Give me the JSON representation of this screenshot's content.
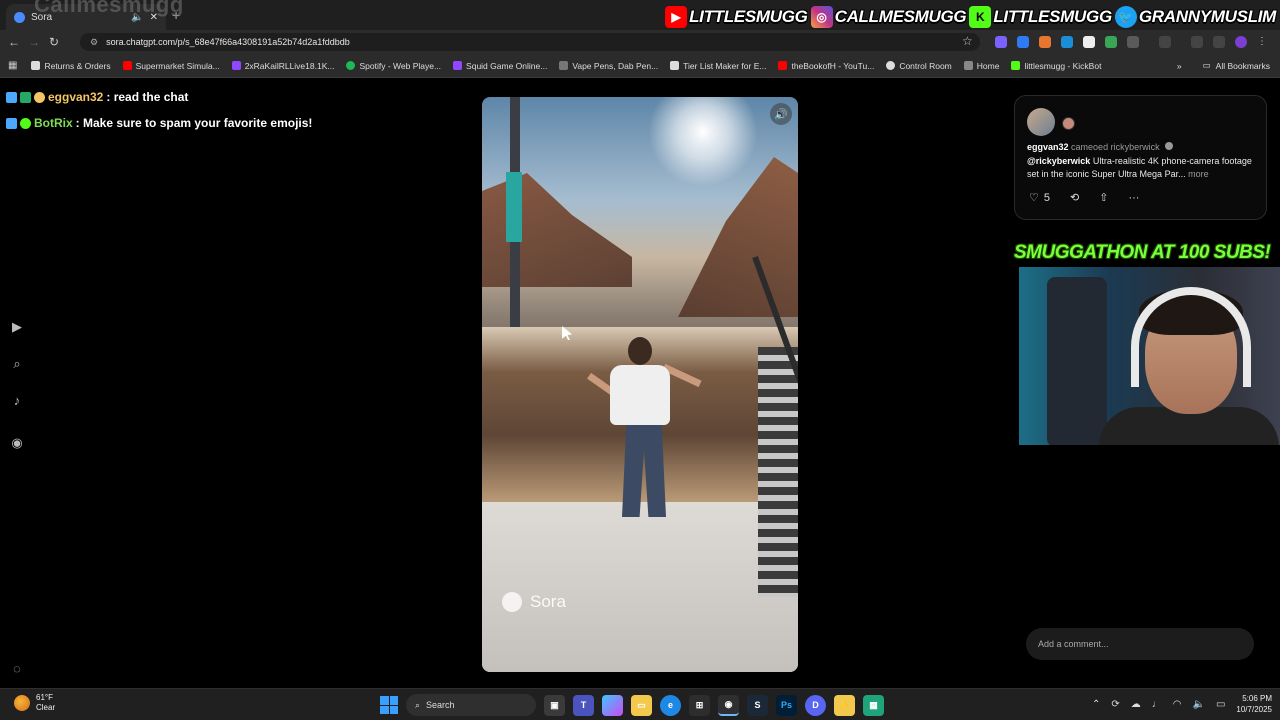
{
  "stream_overlay": {
    "channel_name": "Callmesmugg",
    "socials": [
      {
        "icon": "youtube-icon",
        "handle": "LITTLESMUGG",
        "color": "#ff0000"
      },
      {
        "icon": "instagram-icon",
        "handle": "CALLMESMUGG",
        "color": "#c13584"
      },
      {
        "icon": "kick-icon",
        "handle": "LITTLESMUGG",
        "color": "#53fc18"
      },
      {
        "icon": "twitter-icon",
        "handle": "GRANNYMUSLIM",
        "color": "#1da1f2"
      }
    ],
    "chat": [
      {
        "user": "eggvan32",
        "message": ": read the chat"
      },
      {
        "user": "BotRix",
        "message": ": Make sure to spam your favorite emojis!"
      }
    ],
    "banner": "SMUGGATHON AT 100 SUBS!"
  },
  "browser": {
    "tab_title": "Sora",
    "url": "sora.chatgpt.com/p/s_68e47f66a4308191a52b74d2a1fddbdb",
    "bookmarks": [
      "Returns & Orders",
      "Supermarket Simula...",
      "2xRaKailRLLive18.1K...",
      "Spotify - Web Playe...",
      "Squid Game Online...",
      "Vape Pens, Dab Pen...",
      "Tier List Maker for E...",
      "theBookofH - YouTu...",
      "Control Room",
      "Home",
      "littlesmugg - KickBot"
    ],
    "all_bookmarks": "All Bookmarks"
  },
  "video": {
    "watermark": "Sora"
  },
  "post": {
    "username": "eggvan32",
    "action": "cameoed",
    "target": "rickyberwick",
    "mention": "@rickyberwick",
    "text": "Ultra-realistic 4K phone-camera footage set in the iconic Super Ultra Mega Par...",
    "more": "more",
    "likes": "5"
  },
  "comment": {
    "placeholder": "Add a comment..."
  },
  "taskbar": {
    "temperature": "61°F",
    "condition": "Clear",
    "search_label": "Search",
    "time": "5:06 PM",
    "date": "10/7/2025"
  },
  "colors": {
    "chat_user_a": "#f3c567",
    "chat_user_b": "#7fdd55",
    "banner": "#7aff3a",
    "taskbar": "#202020"
  }
}
